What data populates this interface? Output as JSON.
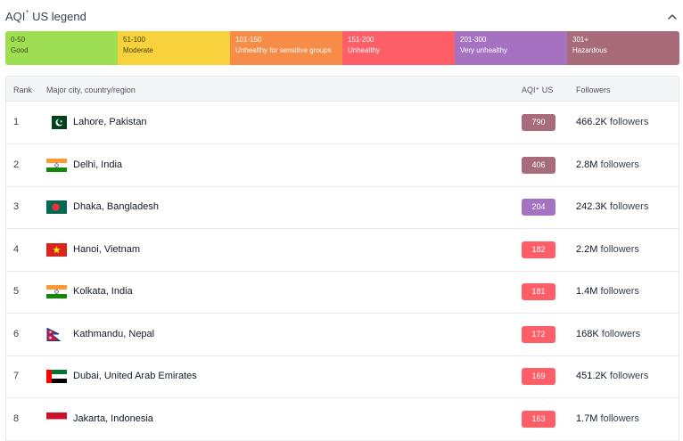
{
  "legend": {
    "title": "AQI",
    "title_sup": "+",
    "title_suffix": " US legend",
    "collapse_icon": "chevron-up-icon",
    "segments": [
      {
        "range": "0-50",
        "label": "Good",
        "color": "#9ede53",
        "text_color": "#3f4a1a"
      },
      {
        "range": "51-100",
        "label": "Moderate",
        "color": "#f8d23c",
        "text_color": "#4a3d0c"
      },
      {
        "range": "101-150",
        "label": "Unhealthy for sensitive groups",
        "color": "#f68c48",
        "text_color": "#ffffff"
      },
      {
        "range": "151-200",
        "label": "Unhealthy",
        "color": "#fd5e67",
        "text_color": "#ffffff"
      },
      {
        "range": "201-300",
        "label": "Very unhealthy",
        "color": "#a572c2",
        "text_color": "#ffffff"
      },
      {
        "range": "301+",
        "label": "Hazardous",
        "color": "#a86b79",
        "text_color": "#ffffff"
      }
    ]
  },
  "table": {
    "headers": {
      "rank": "Rank",
      "city": "Major city, country/region",
      "aqi": "AQI⁺ US",
      "followers": "Followers"
    },
    "rows": [
      {
        "rank": "1",
        "city": "Lahore, Pakistan",
        "flag": "pakistan-flag-icon",
        "aqi": "790",
        "aqi_color": "#a86b79",
        "followers_count": "466.2K",
        "followers_word": " followers"
      },
      {
        "rank": "2",
        "city": "Delhi, India",
        "flag": "india-flag-icon",
        "aqi": "406",
        "aqi_color": "#a86b79",
        "followers_count": "2.8M",
        "followers_word": " followers"
      },
      {
        "rank": "3",
        "city": "Dhaka, Bangladesh",
        "flag": "bangladesh-flag-icon",
        "aqi": "204",
        "aqi_color": "#a572c2",
        "followers_count": "242.3K",
        "followers_word": " followers"
      },
      {
        "rank": "4",
        "city": "Hanoi, Vietnam",
        "flag": "vietnam-flag-icon",
        "aqi": "182",
        "aqi_color": "#fd5e67",
        "followers_count": "2.2M",
        "followers_word": " followers"
      },
      {
        "rank": "5",
        "city": "Kolkata, India",
        "flag": "india-flag-icon",
        "aqi": "181",
        "aqi_color": "#fd5e67",
        "followers_count": "1.4M",
        "followers_word": " followers"
      },
      {
        "rank": "6",
        "city": "Kathmandu, Nepal",
        "flag": "nepal-flag-icon",
        "aqi": "172",
        "aqi_color": "#fd5e67",
        "followers_count": "168K",
        "followers_word": " followers"
      },
      {
        "rank": "7",
        "city": "Dubai, United Arab Emirates",
        "flag": "uae-flag-icon",
        "aqi": "169",
        "aqi_color": "#fd5e67",
        "followers_count": "451.2K",
        "followers_word": " followers"
      },
      {
        "rank": "8",
        "city": "Jakarta, Indonesia",
        "flag": "indonesia-flag-icon",
        "aqi": "163",
        "aqi_color": "#fd5e67",
        "followers_count": "1.7M",
        "followers_word": " followers"
      }
    ]
  }
}
